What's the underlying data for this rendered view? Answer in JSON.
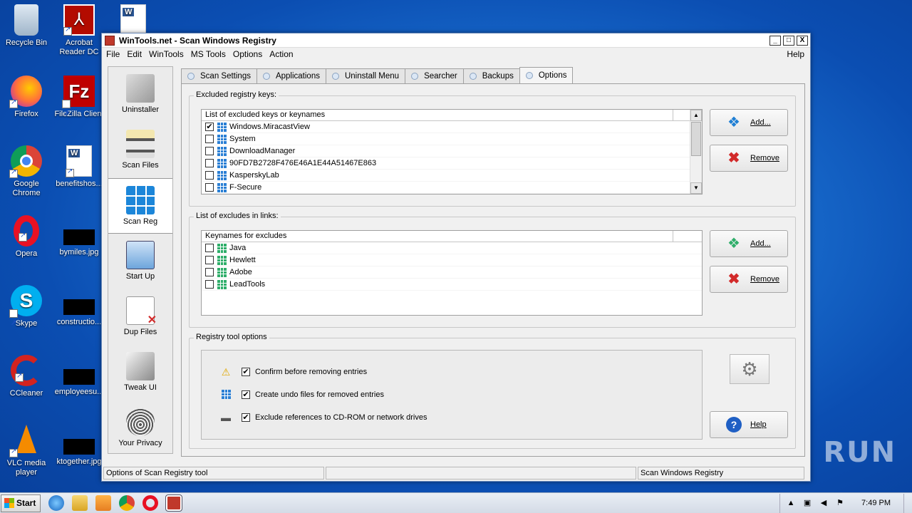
{
  "desktop": {
    "icons": [
      {
        "label": "Recycle Bin"
      },
      {
        "label": "Acrobat Reader DC"
      },
      {
        "label": "Firefox"
      },
      {
        "label": "FileZilla Client"
      },
      {
        "label": "Google Chrome"
      },
      {
        "label": "benefitshos..."
      },
      {
        "label": "Opera"
      },
      {
        "label": "bymiles.jpg"
      },
      {
        "label": "Skype"
      },
      {
        "label": "constructio..."
      },
      {
        "label": "CCleaner"
      },
      {
        "label": "employeesu..."
      },
      {
        "label": "VLC media player"
      },
      {
        "label": "ktogether.jpg"
      }
    ]
  },
  "window": {
    "title": "WinTools.net - Scan Windows Registry",
    "menu": [
      "File",
      "Edit",
      "WinTools",
      "MS Tools",
      "Options",
      "Action"
    ],
    "menu_help": "Help",
    "controls": {
      "minimize": "_",
      "maximize": "□",
      "close": "X"
    }
  },
  "sidebar": {
    "items": [
      {
        "label": "Uninstaller",
        "icon": "uninstaller-icon"
      },
      {
        "label": "Scan Files",
        "icon": "scan-files-icon"
      },
      {
        "label": "Scan Reg",
        "icon": "scan-reg-icon",
        "active": true
      },
      {
        "label": "Start Up",
        "icon": "startup-icon"
      },
      {
        "label": "Dup Files",
        "icon": "dup-files-icon"
      },
      {
        "label": "Tweak UI",
        "icon": "tweak-ui-icon"
      },
      {
        "label": "Your Privacy",
        "icon": "privacy-icon"
      }
    ]
  },
  "tabs": [
    {
      "label": "Scan Settings"
    },
    {
      "label": "Applications"
    },
    {
      "label": "Uninstall Menu"
    },
    {
      "label": "Searcher"
    },
    {
      "label": "Backups"
    },
    {
      "label": "Options",
      "active": true
    }
  ],
  "excluded_keys": {
    "group_title": "Excluded registry keys:",
    "column_header": "List of excluded keys or keynames",
    "rows": [
      {
        "name": "Windows.MiracastView",
        "checked": true
      },
      {
        "name": "System",
        "checked": false
      },
      {
        "name": "DownloadManager",
        "checked": false
      },
      {
        "name": "90FD7B2728F476E46A1E44A51467E863",
        "checked": false
      },
      {
        "name": "KasperskyLab",
        "checked": false
      },
      {
        "name": "F-Secure",
        "checked": false
      }
    ],
    "add_label": "Add...",
    "remove_label": "Remove"
  },
  "excluded_links": {
    "group_title": "List of excludes in links:",
    "column_header": "Keynames for excludes",
    "rows": [
      {
        "name": "Java",
        "checked": false
      },
      {
        "name": "Hewlett",
        "checked": false
      },
      {
        "name": "Adobe",
        "checked": false
      },
      {
        "name": "LeadTools",
        "checked": false
      }
    ],
    "add_label": "Add...",
    "remove_label": "Remove"
  },
  "registry_options": {
    "group_title": "Registry tool options",
    "options": [
      {
        "label": "Confirm before removing entries",
        "checked": true,
        "icon": "warning-icon"
      },
      {
        "label": "Create undo files for removed entries",
        "checked": true,
        "icon": "registry-icon"
      },
      {
        "label": "Exclude references to CD-ROM or network drives",
        "checked": true,
        "icon": "drive-icon"
      }
    ],
    "help_label": "Help"
  },
  "statusbar": {
    "left": "Options of Scan Registry tool",
    "middle": "",
    "right": "Scan Windows Registry"
  },
  "taskbar": {
    "start_label": "Start",
    "clock": "7:49 PM"
  },
  "watermark": "ANY RUN",
  "colors": {
    "desktop_bg": "#1a6fd0",
    "accent_blue": "#2a7fd4",
    "remove_red": "#d22a2a",
    "help_blue": "#1f5fc4"
  }
}
